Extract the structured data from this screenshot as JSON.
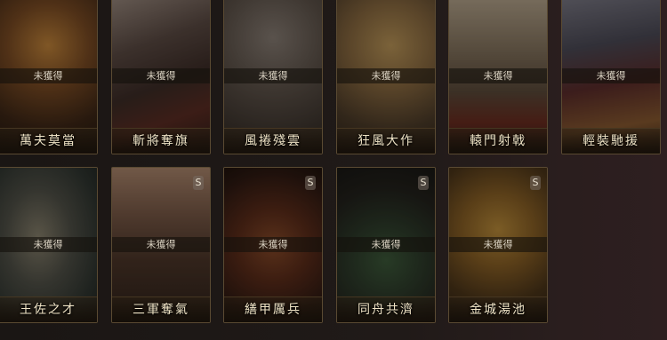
{
  "cards_row1": [
    {
      "status": "未獲得",
      "name": "萬夫莫當"
    },
    {
      "status": "未獲得",
      "name": "斬將奪旗"
    },
    {
      "status": "未獲得",
      "name": "風捲殘雲"
    },
    {
      "status": "未獲得",
      "name": "狂風大作"
    },
    {
      "status": "未獲得",
      "name": "轅門射戟"
    },
    {
      "status": "未獲得",
      "name": "輕裝馳援"
    }
  ],
  "cards_row2": [
    {
      "status": "未獲得",
      "name": "王佐之才"
    },
    {
      "status": "未獲得",
      "name": "三軍奪氣",
      "badge": "S"
    },
    {
      "status": "未獲得",
      "name": "繕甲厲兵",
      "badge": "S"
    },
    {
      "status": "未獲得",
      "name": "同舟共濟",
      "badge": "S"
    },
    {
      "status": "未獲得",
      "name": "金城湯池",
      "badge": "S"
    }
  ],
  "colors": {
    "frame": "#5a4a32",
    "name_text": "#f0e4c6",
    "status_text": "#d8d0c0"
  }
}
